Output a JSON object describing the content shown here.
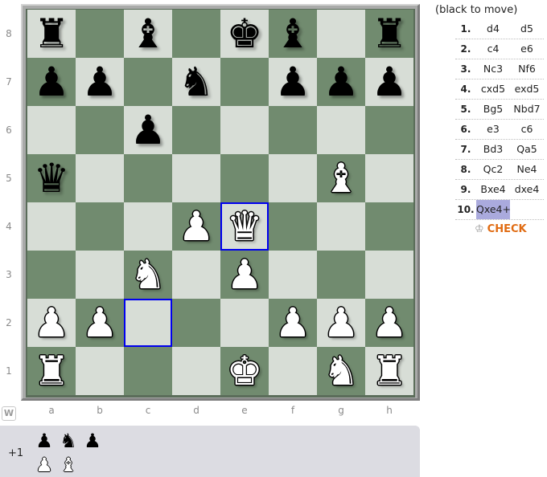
{
  "status": "(black to move)",
  "side_indicator": "W",
  "ranks": [
    "8",
    "7",
    "6",
    "5",
    "4",
    "3",
    "2",
    "1"
  ],
  "files": [
    "a",
    "b",
    "c",
    "d",
    "e",
    "f",
    "g",
    "h"
  ],
  "board": [
    [
      "bR",
      "",
      "bB",
      "",
      "bK",
      "bB",
      "",
      "bR"
    ],
    [
      "bP",
      "bP",
      "",
      "bN",
      "",
      "bP",
      "bP",
      "bP"
    ],
    [
      "",
      "",
      "bP",
      "",
      "",
      "",
      "",
      ""
    ],
    [
      "bQ",
      "",
      "",
      "",
      "",
      "",
      "wB",
      ""
    ],
    [
      "",
      "",
      "",
      "wP",
      "wQ",
      "",
      "",
      ""
    ],
    [
      "",
      "",
      "wN",
      "",
      "wP",
      "",
      "",
      ""
    ],
    [
      "wP",
      "wP",
      "",
      "",
      "",
      "wP",
      "wP",
      "wP"
    ],
    [
      "wR",
      "",
      "",
      "",
      "wK",
      "",
      "wN",
      "wR"
    ]
  ],
  "highlighted_squares": [
    "e4",
    "c2"
  ],
  "piece_glyphs": {
    "K": "♚",
    "Q": "♛",
    "R": "♜",
    "B": "♝",
    "N": "♞",
    "P": "♟"
  },
  "colors": {
    "light_square": "#d7ddd6",
    "dark_square": "#718b6f",
    "highlight": "#0000ee",
    "current_move": "#aaaadd",
    "check": "#e06b12"
  },
  "moves": [
    {
      "num": "1.",
      "white": "d4",
      "black": "d5"
    },
    {
      "num": "2.",
      "white": "c4",
      "black": "e6"
    },
    {
      "num": "3.",
      "white": "Nc3",
      "black": "Nf6"
    },
    {
      "num": "4.",
      "white": "cxd5",
      "black": "exd5"
    },
    {
      "num": "5.",
      "white": "Bg5",
      "black": "Nbd7"
    },
    {
      "num": "6.",
      "white": "e3",
      "black": "c6"
    },
    {
      "num": "7.",
      "white": "Bd3",
      "black": "Qa5"
    },
    {
      "num": "8.",
      "white": "Qc2",
      "black": "Ne4"
    },
    {
      "num": "9.",
      "white": "Bxe4",
      "black": "dxe4"
    },
    {
      "num": "10.",
      "white": "Qxe4+",
      "black": ""
    }
  ],
  "current_move": "10.white",
  "check_label": "CHECK",
  "captured": {
    "material": "+1",
    "by_white": [
      {
        "piece": "P",
        "color": "b"
      },
      {
        "piece": "N",
        "color": "b"
      },
      {
        "piece": "P",
        "color": "b"
      }
    ],
    "by_black": [
      {
        "piece": "P",
        "color": "w"
      },
      {
        "piece": "B",
        "color": "w"
      }
    ]
  }
}
